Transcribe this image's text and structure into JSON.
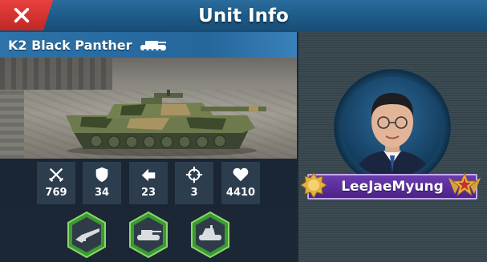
{
  "header": {
    "title": "Unit Info",
    "close_icon": "close-icon"
  },
  "unit": {
    "name": "K2 Black Panther",
    "type_icon": "tank-icon"
  },
  "stats": [
    {
      "icon": "crossed-swords-icon",
      "value": "769"
    },
    {
      "icon": "shield-icon",
      "value": "34"
    },
    {
      "icon": "speed-arrow-icon",
      "value": "23"
    },
    {
      "icon": "crosshair-icon",
      "value": "3"
    },
    {
      "icon": "heart-icon",
      "value": "4410"
    }
  ],
  "badges": [
    {
      "icon": "rifle-icon"
    },
    {
      "icon": "tank-icon"
    },
    {
      "icon": "tank-destroyer-icon"
    }
  ],
  "player": {
    "name": "LeeJaeMyung",
    "rank_left": "gold-medal-icon",
    "rank_right": "winged-star-icon"
  },
  "colors": {
    "header": "#1d5a87",
    "close": "#d63431",
    "name_plate": "#5a2c9c",
    "badge_ring": "#5fb83a"
  }
}
